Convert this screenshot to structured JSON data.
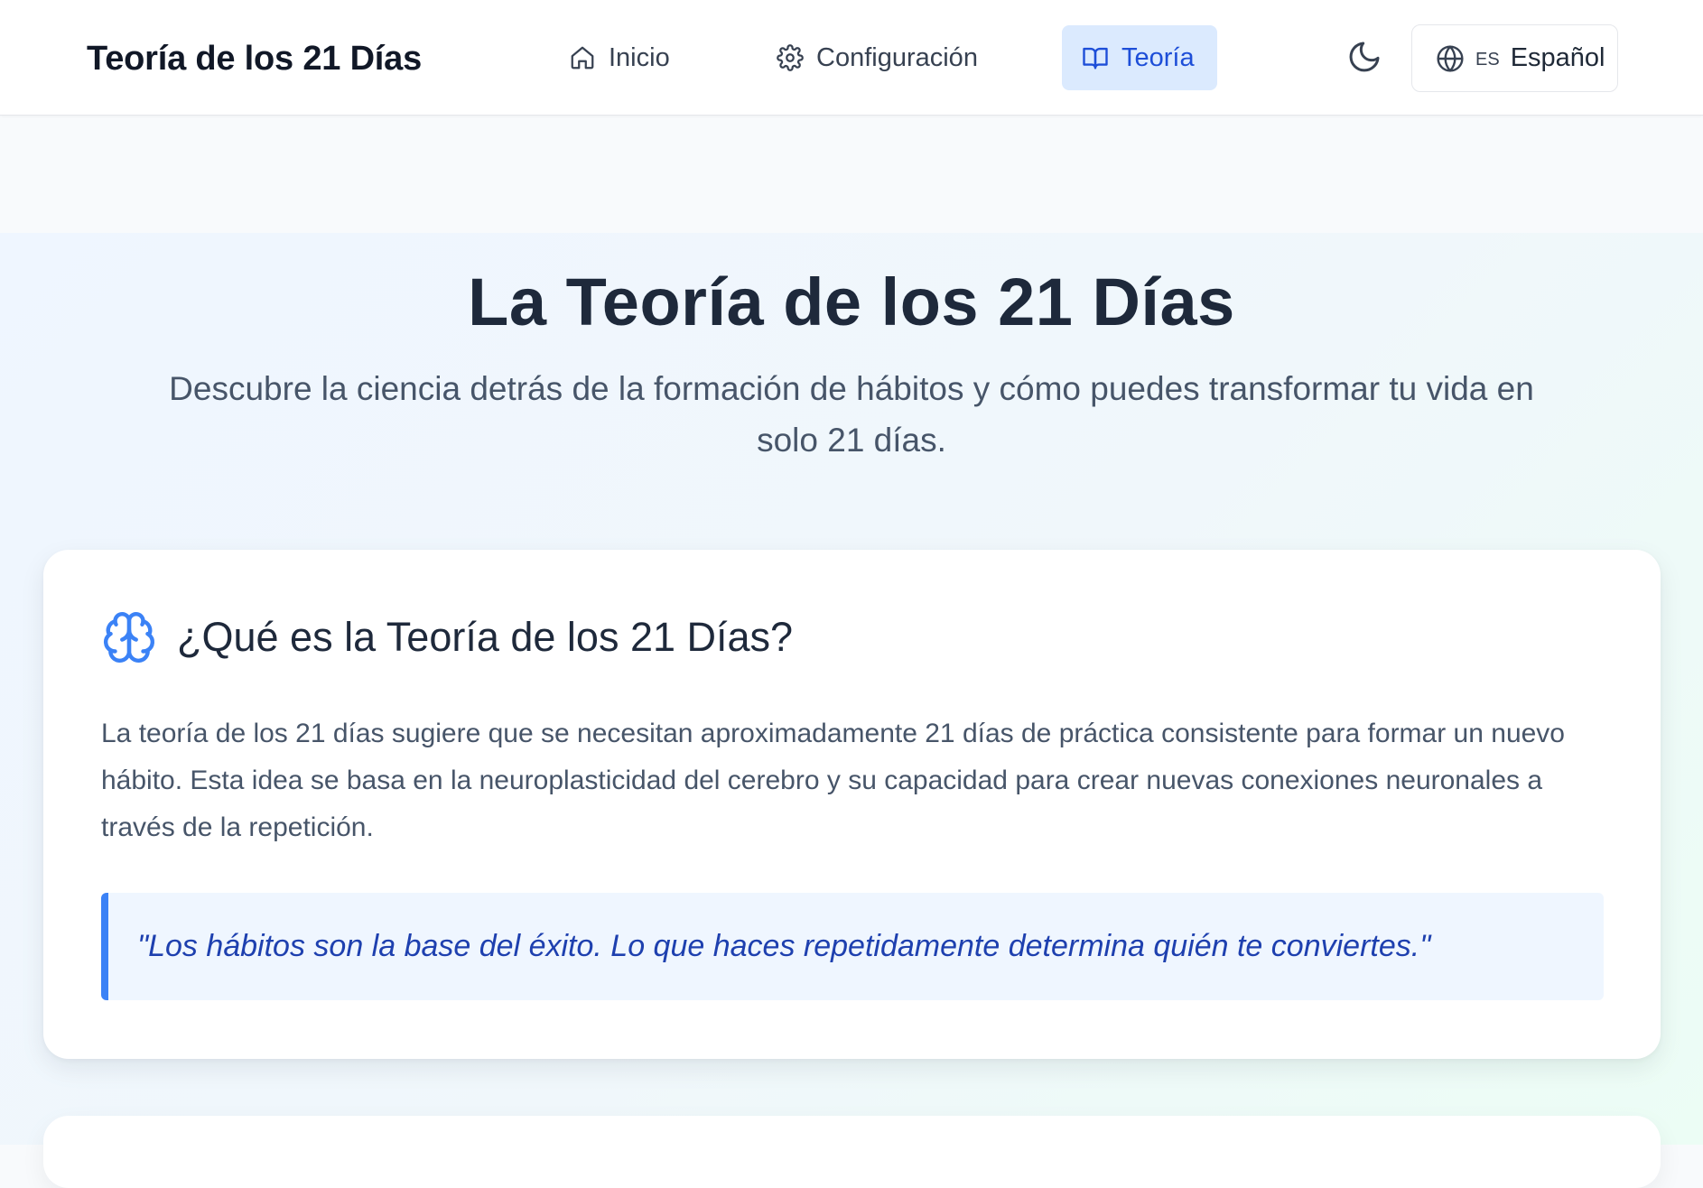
{
  "header": {
    "brand": "Teoría de los 21 Días",
    "nav": {
      "inicio": "Inicio",
      "configuracion": "Configuración",
      "teoria": "Teoría"
    },
    "active_tab": "Teoría",
    "theme_icon": "moon-icon",
    "language": {
      "code": "ES",
      "name": "Español",
      "icon": "globe-icon"
    }
  },
  "hero": {
    "title": "La Teoría de los 21 Días",
    "subtitle": "Descubre la ciencia detrás de la formación de hábitos y cómo puedes transformar tu vida en solo 21 días."
  },
  "section_what": {
    "icon": "brain-icon",
    "title": "¿Qué es la Teoría de los 21 Días?",
    "body": "La teoría de los 21 días sugiere que se necesitan aproximadamente 21 días de práctica consistente para formar un nuevo hábito. Esta idea se basa en la neuroplasticidad del cerebro y su capacidad para crear nuevas conexiones neuronales a través de la repetición.",
    "quote": "\"Los hábitos son la base del éxito. Lo que haces repetidamente determina quién te conviertes.\""
  },
  "colors": {
    "accent": "#3b82f6",
    "active_tab_bg": "#dbeafe",
    "active_tab_text": "#1d4ed8",
    "quote_bg": "#eff6ff",
    "quote_text": "#1e40af"
  }
}
